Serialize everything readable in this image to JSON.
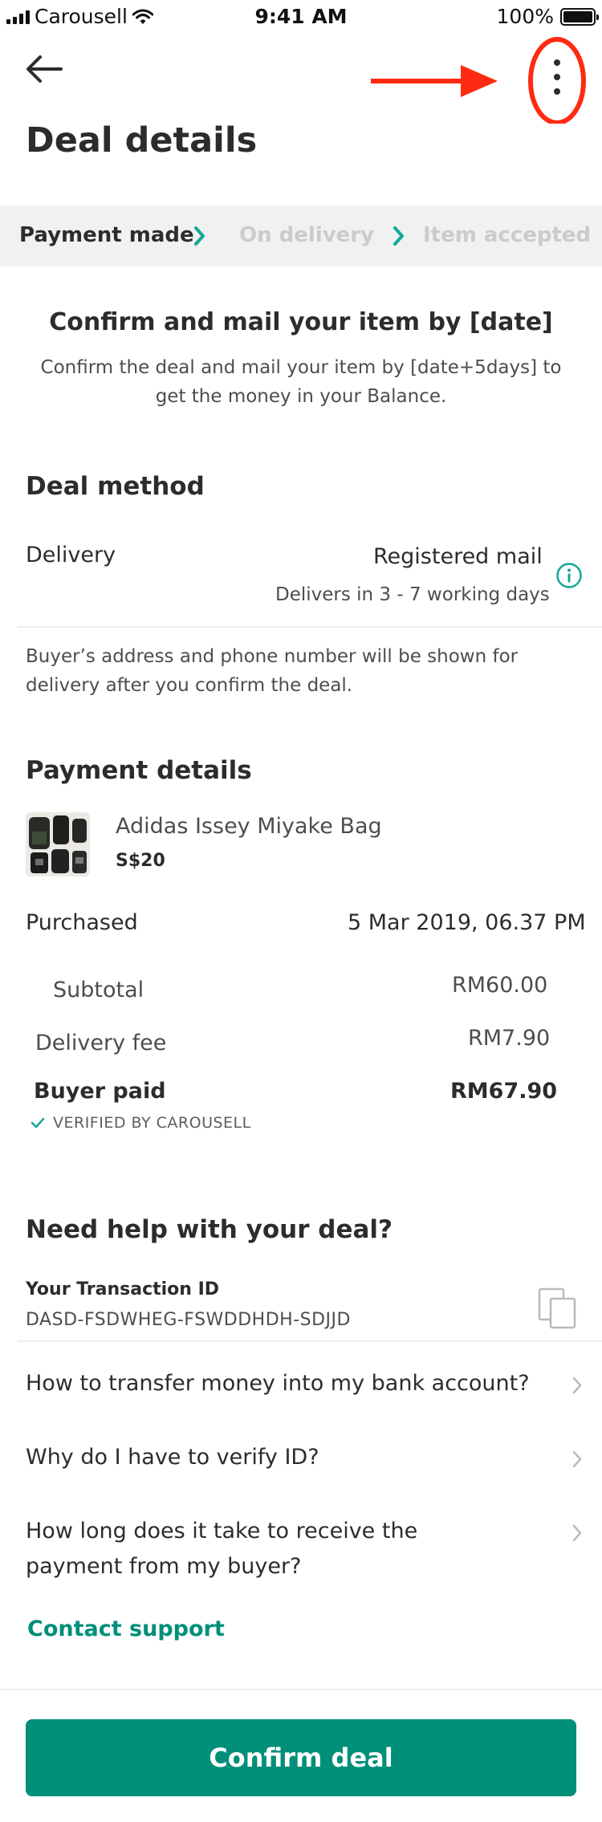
{
  "status_bar": {
    "carrier": "Carousell",
    "time": "9:41 AM",
    "battery": "100%"
  },
  "header": {
    "title": "Deal details",
    "back_icon": "back-arrow-icon",
    "more_icon": "more-vertical-icon",
    "annotation_color": "#ff2a12"
  },
  "steps": [
    {
      "label": "Payment made",
      "state": "active"
    },
    {
      "label": "On delivery",
      "state": "inactive"
    },
    {
      "label": "Item accepted",
      "state": "inactive"
    }
  ],
  "intro": {
    "headline": "Confirm and mail your item by [date]",
    "subline": "Confirm the deal and mail your item by [date+5days] to get the money in your Balance."
  },
  "deal_method": {
    "title": "Deal method",
    "label": "Delivery",
    "value": "Registered mail",
    "note": "Delivers in 3 - 7 working days",
    "disclaimer": "Buyer’s address and phone number will be shown for delivery after you confirm the deal."
  },
  "payment": {
    "title": "Payment details",
    "item_name": "Adidas Issey Miyake Bag",
    "item_price": "S$20",
    "purchased_label": "Purchased",
    "purchased_value": "5 Mar 2019, 06.37 PM",
    "subtotal_label": "Subtotal",
    "subtotal_value": "RM60.00",
    "delivery_label": "Delivery fee",
    "delivery_value": "RM7.90",
    "buyer_paid_label": "Buyer paid",
    "buyer_paid_value": "RM67.90",
    "verified": "VERIFIED BY CAROUSELL"
  },
  "help": {
    "title": "Need help with your deal?",
    "txn_label": "Your Transaction ID",
    "txn_id": "DASD-FSDWHEG-FSWDDHDH-SDJJD",
    "faqs": [
      "How to transfer money into my bank account?",
      "Why do I have to verify ID?",
      "How long does it take to receive the payment from my buyer?"
    ],
    "contact": "Contact support"
  },
  "cta": {
    "label": "Confirm deal",
    "color": "#008f79"
  }
}
